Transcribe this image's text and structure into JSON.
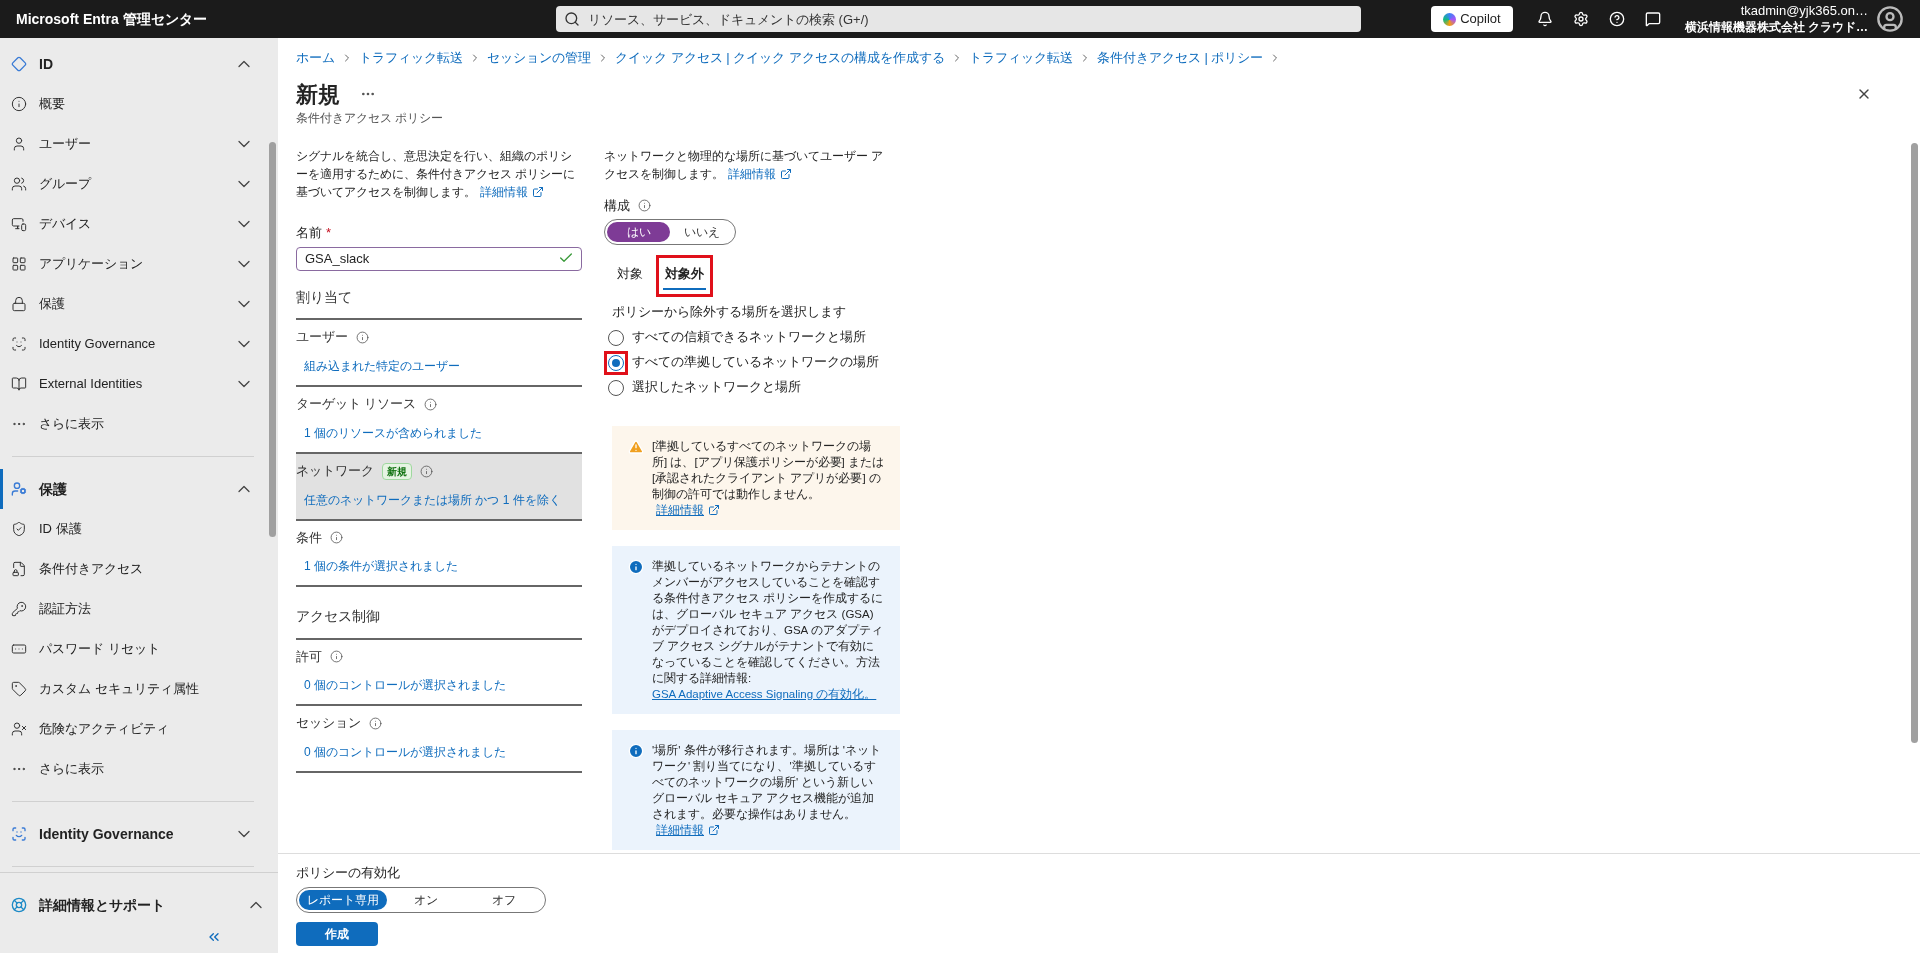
{
  "topbar": {
    "title": "Microsoft Entra 管理センター",
    "search": {
      "placeholder": "リソース、サービス、ドキュメントの検索 (G+/)"
    },
    "copilot": "Copilot",
    "account": {
      "name": "tkadmin@yjk365.on…",
      "org": "横浜情報機器株式会社 クラウド…"
    }
  },
  "sidebar": {
    "sections": [
      {
        "label": "ID",
        "expanded": true,
        "selected": false,
        "children": [
          {
            "label": "概要"
          },
          {
            "label": "ユーザー",
            "expanded": false
          },
          {
            "label": "グループ",
            "expanded": false
          },
          {
            "label": "デバイス",
            "expanded": false
          },
          {
            "label": "アプリケーション",
            "expanded": false
          },
          {
            "label": "保護",
            "expanded": false
          },
          {
            "label": "Identity Governance",
            "expanded": false
          },
          {
            "label": "External Identities",
            "expanded": false
          },
          {
            "label": "さらに表示"
          }
        ]
      },
      {
        "label": "保護",
        "expanded": true,
        "selected": true,
        "children": [
          {
            "label": "ID 保護"
          },
          {
            "label": "条件付きアクセス"
          },
          {
            "label": "認証方法"
          },
          {
            "label": "パスワード リセット"
          },
          {
            "label": "カスタム セキュリティ属性"
          },
          {
            "label": "危険なアクティビティ"
          },
          {
            "label": "さらに表示"
          }
        ]
      },
      {
        "label": "Identity Governance",
        "expanded": false,
        "selected": false
      }
    ],
    "footer": {
      "label": "詳細情報とサポート",
      "expanded": true
    }
  },
  "breadcrumb": [
    "ホーム",
    "トラフィック転送",
    "セッションの管理",
    "クイック アクセス | クイック アクセスの構成を作成する",
    "トラフィック転送",
    "条件付きアクセス | ポリシー"
  ],
  "page": {
    "title": "新規",
    "subtitle": "条件付きアクセス ポリシー"
  },
  "left": {
    "intro": "シグナルを統合し、意思決定を行い、組織のポリシーを適用するために、条件付きアクセス ポリシーに基づいてアクセスを制御します。",
    "intro_link": "詳細情報",
    "name_label": "名前",
    "required_mark": "*",
    "name_value": "GSA_slack",
    "sections": [
      {
        "heading": "割り当て",
        "rows": [
          {
            "label": "ユーザー",
            "value": "組み込まれた特定のユーザー",
            "selected": false
          },
          {
            "label": "ターゲット リソース",
            "value": "1 個のリソースが含められました",
            "selected": false
          },
          {
            "label": "ネットワーク",
            "badge": "新規",
            "value": "任意のネットワークまたは場所 かつ 1 件を除く",
            "selected": true
          },
          {
            "label": "条件",
            "value": "1 個の条件が選択されました",
            "selected": false
          }
        ]
      },
      {
        "heading": "アクセス制御",
        "rows": [
          {
            "label": "許可",
            "value": "0 個のコントロールが選択されました",
            "selected": false
          },
          {
            "label": "セッション",
            "value": "0 個のコントロールが選択されました",
            "selected": false
          }
        ]
      }
    ]
  },
  "right": {
    "intro": "ネットワークと物理的な場所に基づいてユーザー アクセスを制御します。",
    "intro_link": "詳細情報",
    "configure": {
      "label": "構成",
      "options": [
        {
          "label": "はい",
          "selected": true
        },
        {
          "label": "いいえ",
          "selected": false
        }
      ]
    },
    "tabs": [
      {
        "label": "対象",
        "selected": false,
        "highlighted": false
      },
      {
        "label": "対象外",
        "selected": true,
        "highlighted": true
      }
    ],
    "prompt": "ポリシーから除外する場所を選択します",
    "options": [
      {
        "label": "すべての信頼できるネットワークと場所",
        "selected": false,
        "highlighted": false
      },
      {
        "label": "すべての準拠しているネットワークの場所",
        "selected": true,
        "highlighted": true
      },
      {
        "label": "選択したネットワークと場所",
        "selected": false,
        "highlighted": false
      }
    ],
    "notices": [
      {
        "kind": "warning",
        "text": "[準拠しているすべてのネットワークの場所] は、[アプリ保護ポリシーが必要] または [承認されたクライアント アプリが必要] の制御の許可では動作しません。",
        "link": "詳細情報"
      },
      {
        "kind": "info",
        "text": "準拠しているネットワークからテナントのメンバーがアクセスしていることを確認する条件付きアクセス ポリシーを作成するには、グローバル セキュア アクセス (GSA) がデプロイされており、GSA のアダプティブ アクセス シグナルがテナントで有効になっていることを確認してください。方法に関する詳細情報:",
        "block_link": "GSA Adaptive Access Signaling の有効化。"
      },
      {
        "kind": "info",
        "text": "'場所' 条件が移行されます。場所は 'ネットワーク' 割り当てになり、'準拠しているすべてのネットワークの場所' という新しいグローバル セキュア アクセス機能が追加されます。必要な操作はありません。",
        "link": "詳細情報"
      }
    ]
  },
  "policy": {
    "label": "ポリシーの有効化",
    "options": [
      {
        "label": "レポート専用",
        "selected": true
      },
      {
        "label": "オン",
        "selected": false
      },
      {
        "label": "オフ",
        "selected": false
      }
    ],
    "submit": "作成"
  }
}
